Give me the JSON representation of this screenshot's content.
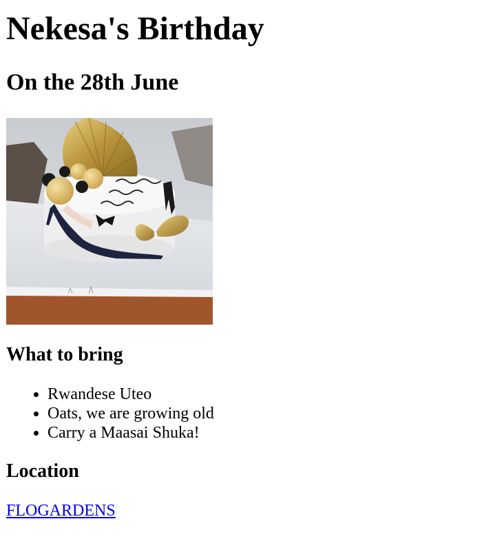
{
  "page": {
    "title": "Nekesa's Birthday",
    "subtitle": "On the 28th June"
  },
  "photo": {
    "description_icon": "cake-photo",
    "cake_text": "Happy B'Day Lena"
  },
  "bring": {
    "heading": "What to bring",
    "items": [
      "Rwandese Uteo",
      "Oats, we are growing old",
      "Carry a Maasai Shuka!"
    ]
  },
  "location": {
    "heading": "Location",
    "link_text": "FLOGARDENS"
  },
  "colors": {
    "link": "#0000ee",
    "text": "#000000",
    "background": "#ffffff"
  }
}
